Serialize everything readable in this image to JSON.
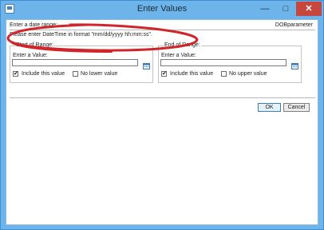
{
  "window": {
    "title": "Enter Values",
    "controls": {
      "minimize": "—",
      "maximize": "□",
      "close": "✕"
    }
  },
  "dialog": {
    "header_label": "Enter a date range:",
    "parameter_name": "DOBparameter",
    "prompt": "Please enter DateTime in format \"mm/dd/yyyy hh:mm:ss\"."
  },
  "start_range": {
    "title": "Start of Range:",
    "value_label": "Enter a Value:",
    "value": "",
    "include_label": "Include this value",
    "include_checked": true,
    "no_bound_label": "No lower value",
    "no_bound_checked": false
  },
  "end_range": {
    "title": "End of Range:",
    "value_label": "Enter a Value:",
    "value": "",
    "include_label": "Include this value",
    "include_checked": true,
    "no_bound_label": "No upper value",
    "no_bound_checked": false
  },
  "buttons": {
    "ok": "OK",
    "cancel": "Cancel"
  },
  "icons": {
    "app": "dialog-app-icon",
    "calendar": "calendar-icon",
    "check": "✔"
  },
  "colors": {
    "title_bar": "#6cb4ea",
    "close_button": "#c7463d",
    "annotation": "#d0262b",
    "calendar": "#3a78c1"
  }
}
